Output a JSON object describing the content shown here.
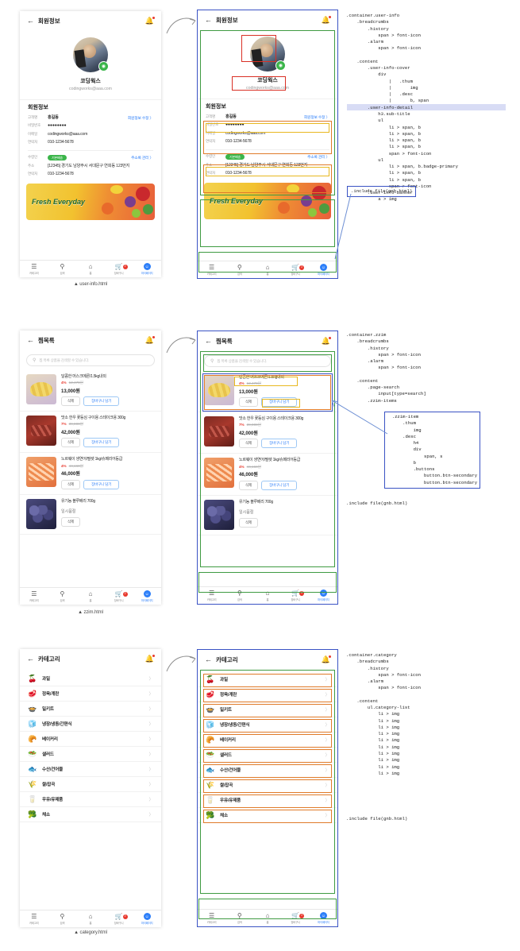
{
  "gnb": {
    "items": [
      {
        "label": "카테고리",
        "icon": "menu-icon",
        "glyph": "☰",
        "active": false,
        "badge": ""
      },
      {
        "label": "검색",
        "icon": "search-icon",
        "glyph": "🔍",
        "active": false,
        "badge": ""
      },
      {
        "label": "홈",
        "icon": "home-icon",
        "glyph": "⌂",
        "active": false,
        "badge": ""
      },
      {
        "label": "장바구니",
        "icon": "cart-icon",
        "glyph": "🛒",
        "active": false,
        "badge": "2"
      },
      {
        "label": "마이페이지",
        "icon": "avatar-icon",
        "glyph": "☻",
        "active": true,
        "badge": ""
      }
    ]
  },
  "sections": [
    {
      "id": "user-info",
      "caption": "▲ user-info.html",
      "header": {
        "back": "←",
        "title": "회원정보",
        "alarm": "bell-icon"
      },
      "cover": {
        "name": "코딩웍스",
        "email": "codingworks@aaa.com",
        "camera": "camera-icon"
      },
      "sub_title": "회원정보",
      "account_rows": [
        {
          "key": "고객명",
          "value": "홍길동",
          "bold": true,
          "link": "회원정보 수정 〉"
        },
        {
          "key": "비밀번호",
          "value": "●●●●●●●●",
          "bold": false,
          "link": ""
        },
        {
          "key": "이메일",
          "value": "codingworks@aaa.com",
          "bold": false,
          "link": ""
        },
        {
          "key": "연락처",
          "value": "010-1234-5678",
          "bold": false,
          "link": ""
        }
      ],
      "address_rows": [
        {
          "key": "수령인",
          "badge": "기본배송",
          "value": "",
          "link": "주소록 관리 〉"
        },
        {
          "key": "주소",
          "value": "[12345] 경기도 남양주시 서대문구 연희동 123번지",
          "link": ""
        },
        {
          "key": "연락처",
          "value": "010-1234-5678",
          "link": ""
        }
      ],
      "banner": {
        "text": "Fresh Everyday"
      },
      "code": ".container.user-info\n    .breadcrumbs\n        .history\n            span > font-icon\n        .alarm\n            span > font-icon\n\n    .content\n        .user-info-cover\n            div\n                |   .thum\n                |       img\n                |   .desc\n                |       b, span\n        .user-info-detail\n            h3.sub-title\n            ul\n                li > span, b\n                li > span, b\n                li > span, b\n                li > span, b\n                span > font-icon\n            ul\n                li > span, b.badge-primary\n                li > span, b\n                li > span, b\n                span > font-icon\n        .user-info-banner\n            a > img",
      "code_highlight": ".user-info-detail",
      "include": ".include file(gnb.html)"
    },
    {
      "id": "zzim",
      "caption": "▲ zzim.html",
      "header": {
        "back": "←",
        "title": "찜목록",
        "alarm": "bell-icon"
      },
      "search": {
        "placeholder": "찜 목록 상품을 검색할 수 있습니다.",
        "icon": "search-icon"
      },
      "items": [
        {
          "name": "달콤한 머스크메론/1.5kg내외",
          "rate": "4%",
          "old_price": "12,470원",
          "price": "13,000원",
          "soldout": "",
          "buttons": [
            "삭제",
            "장바구니 담기"
          ],
          "thumb_class": "th-melon"
        },
        {
          "name": "맛소 한우 꽃등심 구이용 스테이크용 300g",
          "rate": "7%",
          "old_price": "39,000원",
          "price": "42,000원",
          "soldout": "",
          "buttons": [
            "삭제",
            "장바구니 담기"
          ],
          "thumb_class": "th-beef"
        },
        {
          "name": "노르웨이 생연어/필렛 1kg/슈페리어등급",
          "rate": "4%",
          "old_price": "44,160원",
          "price": "46,000원",
          "soldout": "",
          "buttons": [
            "삭제",
            "장바구니 담기"
          ],
          "thumb_class": "th-salmon"
        },
        {
          "name": "유기농 블루베리 700g",
          "rate": "",
          "old_price": "",
          "price": "",
          "soldout": "일시품절",
          "buttons": [
            "삭제"
          ],
          "thumb_class": "th-berry"
        }
      ],
      "code": ".container.zzim\n    .breadcrumbs\n        .history\n            span > font-icon\n        .alarm\n            span > font-icon\n\n    .content\n        .page-search\n            input[type=search]\n        .zzim-items",
      "code_box": "  .zzim-item\n      .thum\n          img\n      .desc\n          h4\n          div\n              span, s\n          b\n          .buttons\n              button.btn-secondary\n              button.btn-secondary",
      "include": ".include file(gnb.html)"
    },
    {
      "id": "category",
      "caption": "▲ category.html",
      "header": {
        "back": "←",
        "title": "카테고리",
        "alarm": "bell-icon"
      },
      "categories": [
        {
          "label": "과일",
          "icon": "fruit-icon",
          "glyph": "🍒"
        },
        {
          "label": "정육/계란",
          "icon": "meat-icon",
          "glyph": "🥩"
        },
        {
          "label": "밀키트",
          "icon": "mealkit-icon",
          "glyph": "🍲"
        },
        {
          "label": "냉장/냉동/간편식",
          "icon": "frozen-icon",
          "glyph": "🧊"
        },
        {
          "label": "베이커리",
          "icon": "bakery-icon",
          "glyph": "🥐"
        },
        {
          "label": "샐러드",
          "icon": "salad-icon",
          "glyph": "🥗"
        },
        {
          "label": "수산/건어물",
          "icon": "seafood-icon",
          "glyph": "🐟"
        },
        {
          "label": "쌀/잡곡",
          "icon": "rice-icon",
          "glyph": "🌾"
        },
        {
          "label": "우유/유제품",
          "icon": "milk-icon",
          "glyph": "🥛"
        },
        {
          "label": "채소",
          "icon": "vegetable-icon",
          "glyph": "🥦"
        }
      ],
      "chevron": "〉",
      "code": ".container.category\n    .breadcrumbs\n        .history\n            span > font-icon\n        .alarm\n            span > font-icon\n\n    .content\n        ul.category-list\n            li > img\n            li > img\n            li > img\n            li > img\n            li > img\n            li > img\n            li > img\n            li > img\n            li > img\n            li > img",
      "include": ".include file(gnb.html)"
    }
  ]
}
